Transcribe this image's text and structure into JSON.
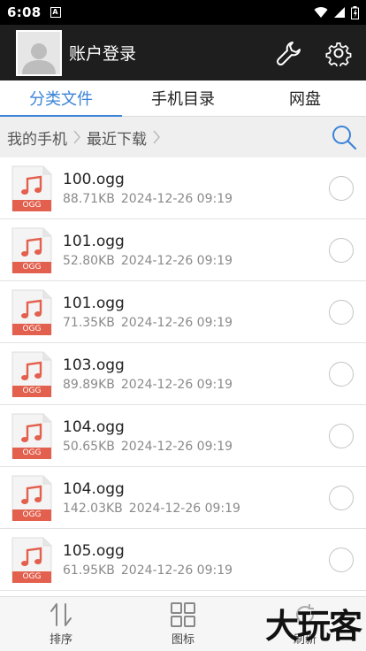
{
  "status_bar": {
    "time": "6:08",
    "sim_badge": "A"
  },
  "header": {
    "title": "账户登录",
    "avatar_icon": "default-user-icon",
    "actions": [
      "wrench-icon",
      "gear-icon"
    ]
  },
  "tabs": [
    {
      "label": "分类文件",
      "active": true
    },
    {
      "label": "手机目录",
      "active": false
    },
    {
      "label": "网盘",
      "active": false
    }
  ],
  "breadcrumb": {
    "items": [
      "我的手机",
      "最近下载"
    ],
    "search_icon": "search-icon"
  },
  "files": [
    {
      "name": "100.ogg",
      "size": "88.71KB",
      "date": "2024-12-26 09:19",
      "type": "OGG"
    },
    {
      "name": "101.ogg",
      "size": "52.80KB",
      "date": "2024-12-26 09:19",
      "type": "OGG"
    },
    {
      "name": "101.ogg",
      "size": "71.35KB",
      "date": "2024-12-26 09:19",
      "type": "OGG"
    },
    {
      "name": "103.ogg",
      "size": "89.89KB",
      "date": "2024-12-26 09:19",
      "type": "OGG"
    },
    {
      "name": "104.ogg",
      "size": "50.65KB",
      "date": "2024-12-26 09:19",
      "type": "OGG"
    },
    {
      "name": "104.ogg",
      "size": "142.03KB",
      "date": "2024-12-26 09:19",
      "type": "OGG"
    },
    {
      "name": "105.ogg",
      "size": "61.95KB",
      "date": "2024-12-26 09:19",
      "type": "OGG"
    }
  ],
  "toolbar": {
    "sort_label": "排序",
    "icon_view_label": "图标",
    "refresh_label": "刷新"
  },
  "watermark": "大玩客",
  "colors": {
    "accent": "#3b83d8",
    "ogg_badge": "#e2604d",
    "header_bg": "#1e1e1e"
  }
}
